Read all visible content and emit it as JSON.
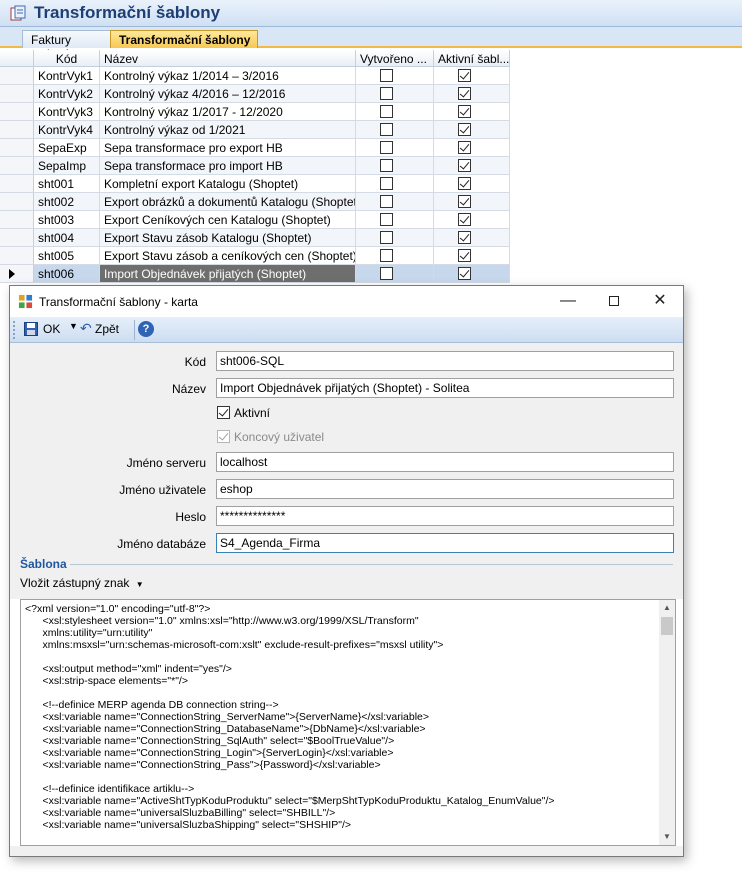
{
  "main": {
    "title": "Transformační šablony",
    "tabs": [
      {
        "label": "Faktury vydané"
      },
      {
        "label": "Transformační šablony"
      }
    ]
  },
  "grid": {
    "columns": [
      "Kód",
      "Název",
      "Vytvořeno ...",
      "Aktivní šabl..."
    ],
    "rows": [
      {
        "code": "KontrVyk1",
        "name": "Kontrolný výkaz 1/2014 – 3/2016",
        "created": false,
        "active": true
      },
      {
        "code": "KontrVyk2",
        "name": "Kontrolný výkaz 4/2016 – 12/2016",
        "created": false,
        "active": true
      },
      {
        "code": "KontrVyk3",
        "name": "Kontrolný výkaz 1/2017 - 12/2020",
        "created": false,
        "active": true
      },
      {
        "code": "KontrVyk4",
        "name": "Kontrolný výkaz od 1/2021",
        "created": false,
        "active": true
      },
      {
        "code": "SepaExp",
        "name": "Sepa transformace pro export HB",
        "created": false,
        "active": true
      },
      {
        "code": "SepaImp",
        "name": "Sepa transformace pro import HB",
        "created": false,
        "active": true
      },
      {
        "code": "sht001",
        "name": "Kompletní export Katalogu (Shoptet)",
        "created": false,
        "active": true
      },
      {
        "code": "sht002",
        "name": "Export obrázků a dokumentů Katalogu (Shoptet)",
        "created": false,
        "active": true
      },
      {
        "code": "sht003",
        "name": "Export Ceníkových cen Katalogu (Shoptet)",
        "created": false,
        "active": true
      },
      {
        "code": "sht004",
        "name": "Export Stavu zásob Katalogu (Shoptet)",
        "created": false,
        "active": true
      },
      {
        "code": "sht005",
        "name": "Export Stavu zásob a ceníkových cen (Shoptet)",
        "created": false,
        "active": true
      },
      {
        "code": "sht006",
        "name": "Import Objednávek přijatých (Shoptet)",
        "created": false,
        "active": true
      }
    ],
    "selected_index": 11
  },
  "dialog": {
    "title": "Transformační šablony - karta",
    "toolbar": {
      "ok_label": "OK",
      "back_label": "Zpět"
    },
    "fields": {
      "kod_label": "Kód",
      "kod_value": "sht006-SQL",
      "nazev_label": "Název",
      "nazev_value": "Import Objednávek přijatých (Shoptet) - Solitea",
      "aktivni_label": "Aktivní",
      "aktivni_checked": true,
      "koncovy_label": "Koncový uživatel",
      "koncovy_checked": true,
      "server_label": "Jméno serveru",
      "server_value": "localhost",
      "user_label": "Jméno uživatele",
      "user_value": "eshop",
      "heslo_label": "Heslo",
      "heslo_value": "**************",
      "db_label": "Jméno databáze",
      "db_value": "S4_Agenda_Firma"
    },
    "section_title": "Šablona",
    "insert_label": "Vložit zástupný znak",
    "code_lines": [
      "<?xml version=\"1.0\" encoding=\"utf-8\"?>",
      "      <xsl:stylesheet version=\"1.0\" xmlns:xsl=\"http://www.w3.org/1999/XSL/Transform\"",
      "      xmlns:utility=\"urn:utility\"",
      "      xmlns:msxsl=\"urn:schemas-microsoft-com:xslt\" exclude-result-prefixes=\"msxsl utility\">",
      "",
      "      <xsl:output method=\"xml\" indent=\"yes\"/>",
      "      <xsl:strip-space elements=\"*\"/>",
      "",
      "      <!--definice MERP agenda DB connection string-->",
      "      <xsl:variable name=\"ConnectionString_ServerName\">{ServerName}</xsl:variable>",
      "      <xsl:variable name=\"ConnectionString_DatabaseName\">{DbName}</xsl:variable>",
      "      <xsl:variable name=\"ConnectionString_SqlAuth\" select=\"$BoolTrueValue\"/>",
      "      <xsl:variable name=\"ConnectionString_Login\">{ServerLogin}</xsl:variable>",
      "      <xsl:variable name=\"ConnectionString_Pass\">{Password}</xsl:variable>",
      "",
      "      <!--definice identifikace artiklu-->",
      "      <xsl:variable name=\"ActiveShtTypKoduProduktu\" select=\"$MerpShtTypKoduProduktu_Katalog_EnumValue\"/>",
      "      <xsl:variable name=\"universalSluzbaBilling\" select=\"SHBILL\"/>",
      "      <xsl:variable name=\"universalSluzbaShipping\" select=\"SHSHIP\"/>"
    ]
  }
}
